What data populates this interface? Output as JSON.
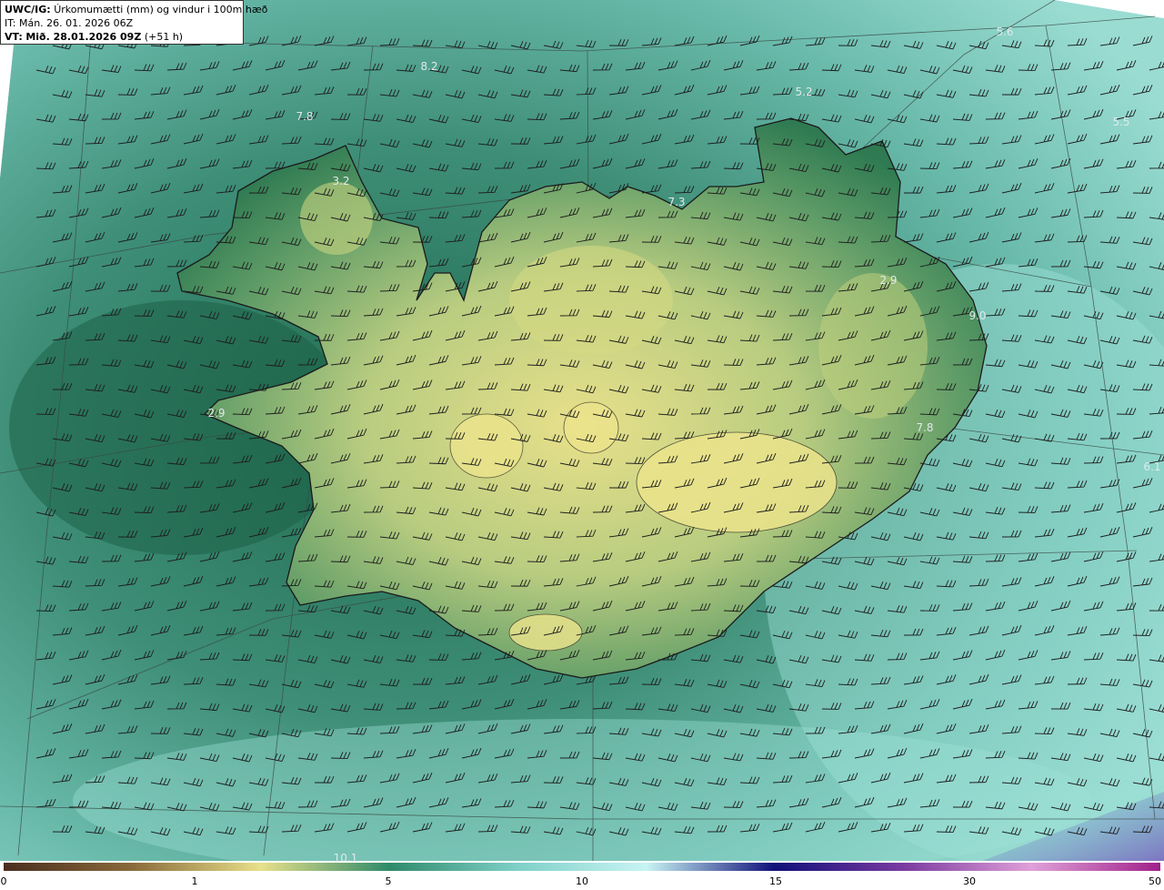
{
  "header": {
    "model_label": "UWC/IG:",
    "title": "Úrkomumætti (mm) og vindur i 100m hæð",
    "init_time": "IT: Mán. 26. 01. 2026 06Z",
    "valid_label": "VT:",
    "valid_time": "Mið. 28.01.2026 09Z",
    "lead_time": "(+51 h)"
  },
  "value_labels": [
    "5.6",
    "8.2",
    "5.2",
    "5.5",
    "7.8",
    "3.2",
    "7.3",
    "2.9",
    "9.0",
    "2.9",
    "7.8",
    "6.1",
    "10.1"
  ],
  "colorbar": {
    "ticks": [
      "0",
      "1",
      "5",
      "10",
      "15",
      "30",
      "50"
    ],
    "colors": [
      "#4a2e1e",
      "#8a6a3a",
      "#e8e08a",
      "#2f8a6a",
      "#7fd0c8",
      "#c8f4f4",
      "#10107a",
      "#7a3aa0",
      "#e0a0d8",
      "#a0208a"
    ]
  },
  "map": {
    "ocean_colors": [
      "#1f6a4e",
      "#5aa896",
      "#8fd4ca"
    ],
    "land_colors": [
      "#2f7a52",
      "#a8c878",
      "#e8e08a"
    ],
    "coast_color": "#1a1a1a"
  }
}
